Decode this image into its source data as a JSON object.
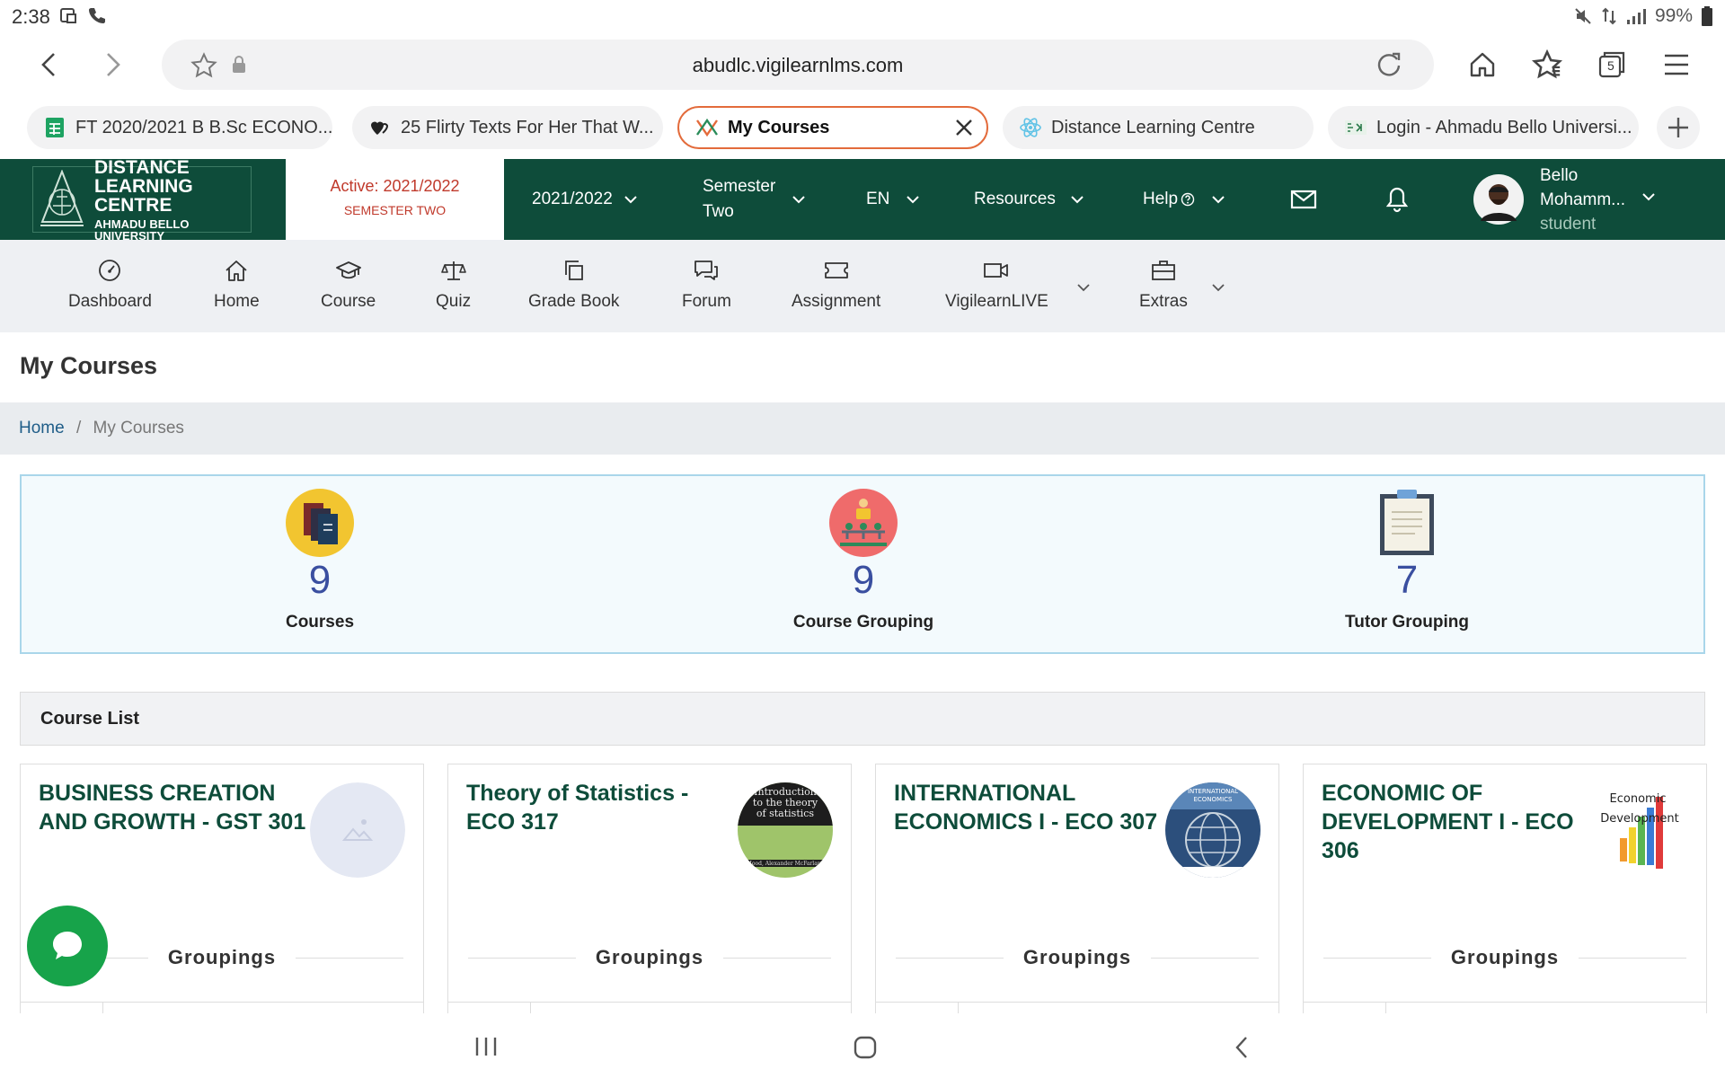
{
  "status_bar": {
    "time": "2:38",
    "battery": "99%",
    "icons": [
      "screenshot-icon",
      "call-icon",
      "mute-icon",
      "data-icon",
      "signal-icon",
      "battery-icon"
    ]
  },
  "browser": {
    "url": "abudlc.vigilearnlms.com",
    "tab_count": "5",
    "tabs": [
      {
        "title": "FT 2020/2021 B B.Sc ECONO...",
        "icon": "sheets-icon"
      },
      {
        "title": "25 Flirty Texts For Her That W...",
        "icon": "hearts-icon"
      },
      {
        "title": "My Courses",
        "icon": "vigilearn-icon",
        "active": true
      },
      {
        "title": "Distance Learning Centre",
        "icon": "react-icon"
      },
      {
        "title": "Login - Ahmadu Bello Universi...",
        "icon": "abu-icon"
      }
    ]
  },
  "header": {
    "logo": {
      "line1": "DISTANCE",
      "line2": "LEARNING CENTRE",
      "line3": "AHMADU BELLO UNIVERSITY"
    },
    "active_session": "Active: 2021/2022",
    "active_semester": "SEMESTER TWO",
    "session_select": "2021/2022",
    "semester_select": {
      "line1": "Semester",
      "line2": "Two"
    },
    "language": "EN",
    "resources": "Resources",
    "help": "Help",
    "user": {
      "first": "Bello",
      "last": "Mohamm...",
      "role": "student"
    }
  },
  "module_nav": [
    {
      "label": "Dashboard",
      "icon": "dashboard-icon"
    },
    {
      "label": "Home",
      "icon": "home-icon"
    },
    {
      "label": "Course",
      "icon": "graduation-cap-icon"
    },
    {
      "label": "Quiz",
      "icon": "scale-icon"
    },
    {
      "label": "Grade Book",
      "icon": "copy-icon"
    },
    {
      "label": "Forum",
      "icon": "chat-bubbles-icon"
    },
    {
      "label": "Assignment",
      "icon": "ticket-icon"
    },
    {
      "label": "VigilearnLIVE",
      "icon": "video-icon"
    },
    {
      "label": "Extras",
      "icon": "briefcase-icon"
    }
  ],
  "page": {
    "title": "My Courses",
    "breadcrumb": {
      "home": "Home",
      "separator": "/",
      "current": "My Courses"
    }
  },
  "stats": [
    {
      "value": "9",
      "label": "Courses",
      "icon": "books-icon"
    },
    {
      "value": "9",
      "label": "Course Grouping",
      "icon": "presenter-icon"
    },
    {
      "value": "7",
      "label": "Tutor Grouping",
      "icon": "clipboard-icon"
    }
  ],
  "course_list": {
    "heading": "Course List",
    "courses": [
      {
        "title": "BUSINESS CREATION AND GROWTH - GST 301",
        "groupings": "Groupings",
        "thumb": "placeholder-image-icon"
      },
      {
        "title": "Theory of Statistics - ECO 317",
        "groupings": "Groupings",
        "thumb": "book-cover",
        "thumb_text": [
          "Introduction",
          "to the theory",
          "of statistics",
          "Mood, Alexander McFarlane"
        ]
      },
      {
        "title": "INTERNATIONAL ECONOMICS I - ECO 307",
        "groupings": "Groupings",
        "thumb": "globe-cover",
        "thumb_text": [
          "INTERNATIONAL",
          "ECONOMICS"
        ]
      },
      {
        "title": "ECONOMIC OF DEVELOPMENT I - ECO 306",
        "groupings": "Groupings",
        "thumb": "bar-chart-cover",
        "thumb_text": [
          "Economic",
          "Development"
        ]
      }
    ]
  },
  "colors": {
    "header_bg": "#0e4c3a",
    "course_title": "#0e4c3a",
    "active_text": "#c0392b",
    "stat_number": "#3a4fa0",
    "chat_button": "#17a34a",
    "active_tab_border": "#e36b3b"
  }
}
